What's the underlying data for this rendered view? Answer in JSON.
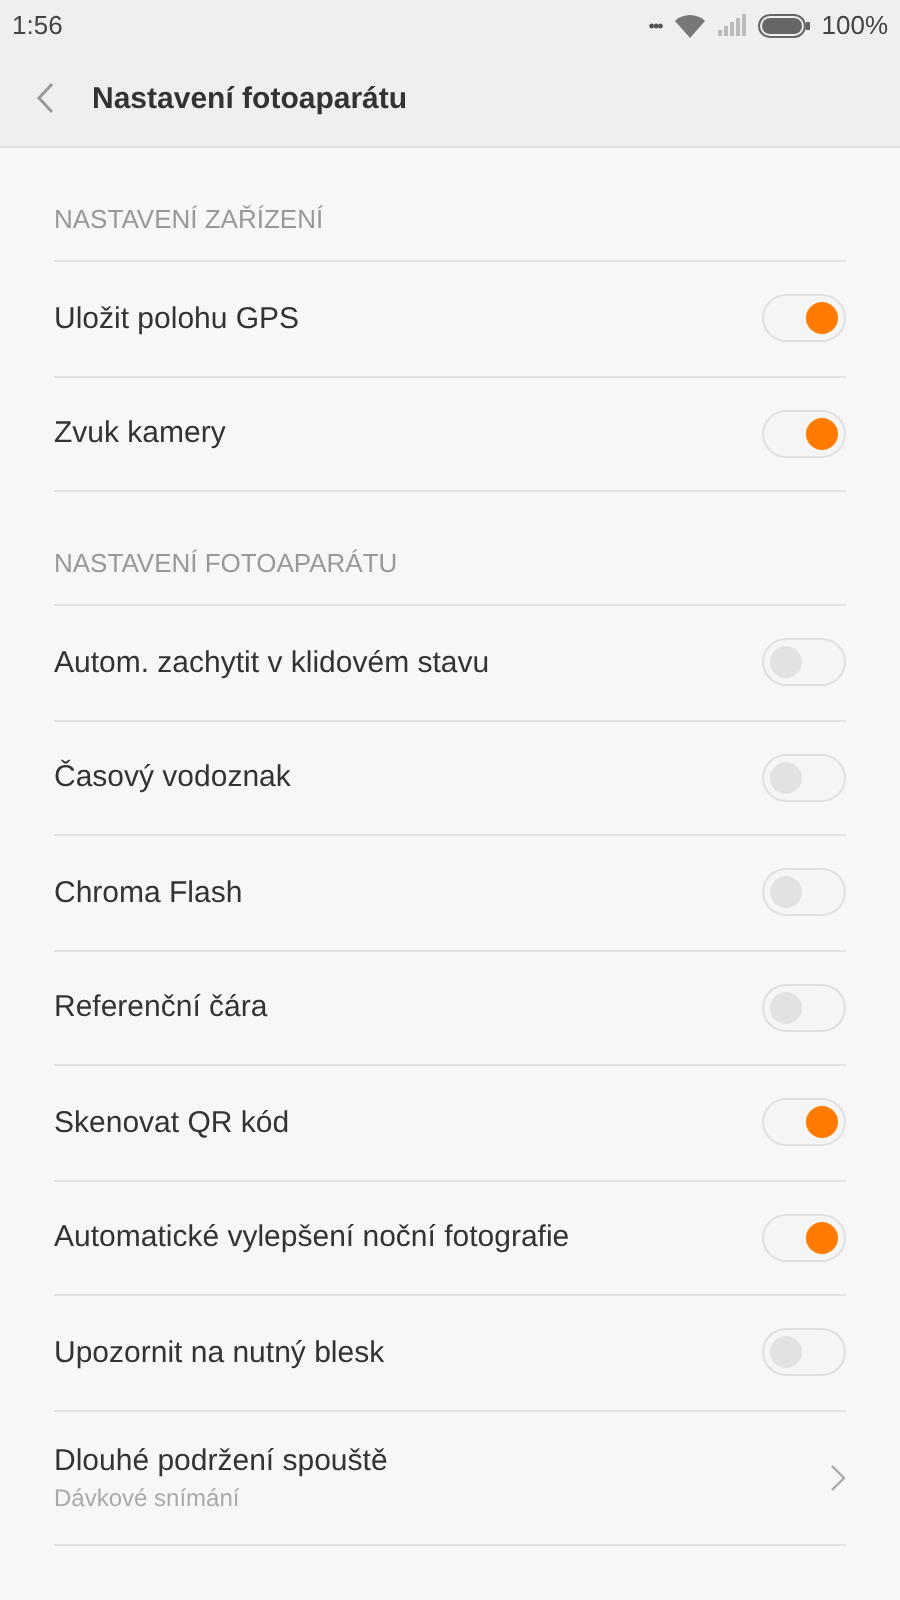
{
  "status_bar": {
    "time": "1:56",
    "dots": "•••",
    "battery": "100%"
  },
  "header": {
    "title": "Nastavení fotoaparátu"
  },
  "sections": [
    {
      "title": "NASTAVENÍ ZAŘÍZENÍ",
      "items": [
        {
          "kind": "toggle",
          "label": "Uložit polohu GPS",
          "on": true
        },
        {
          "kind": "toggle",
          "label": "Zvuk kamery",
          "on": true
        }
      ]
    },
    {
      "title": "NASTAVENÍ FOTOAPARÁTU",
      "items": [
        {
          "kind": "toggle",
          "label": "Autom. zachytit v klidovém stavu",
          "on": false
        },
        {
          "kind": "toggle",
          "label": "Časový vodoznak",
          "on": false
        },
        {
          "kind": "toggle",
          "label": "Chroma Flash",
          "on": false
        },
        {
          "kind": "toggle",
          "label": "Referenční čára",
          "on": false
        },
        {
          "kind": "toggle",
          "label": "Skenovat QR kód",
          "on": true
        },
        {
          "kind": "toggle",
          "label": "Automatické vylepšení noční fotografie",
          "on": true
        },
        {
          "kind": "toggle",
          "label": "Upozornit na nutný blesk",
          "on": false
        },
        {
          "kind": "link",
          "label": "Dlouhé podržení spouště",
          "value": "Dávkové snímání"
        }
      ]
    }
  ]
}
